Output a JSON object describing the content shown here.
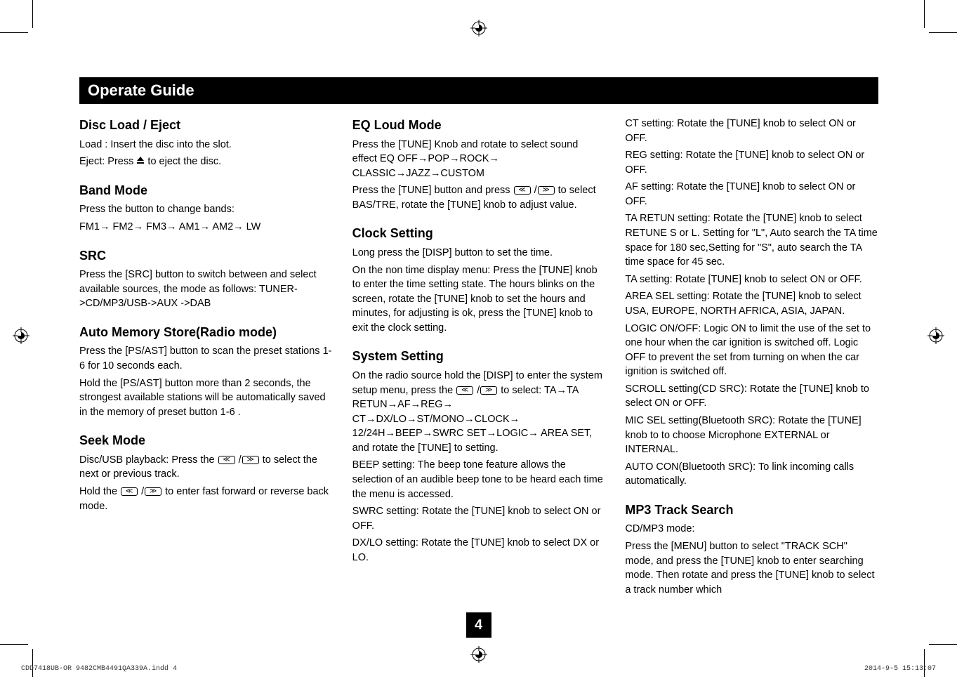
{
  "section_title": "Operate Guide",
  "page_number": "4",
  "footer_left": "CDD7418UB-OR 9482CMB4491QA339A.indd   4",
  "footer_right": "2014-9-5   15:13:07",
  "col1": {
    "h1": "Disc Load / Eject",
    "p1a": "Load : Insert the disc into the slot.",
    "p1b_pre": "Eject: Press ",
    "p1b_post": " to eject the disc.",
    "h2": "Band Mode",
    "p2a": "Press the button to change  bands:",
    "p2b": "FM1→ FM2→ FM3→ AM1→ AM2→ LW",
    "h3": "SRC",
    "p3": "Press the [SRC] button to switch between and select available sources, the mode as follows: TUNER->CD/MP3/USB->AUX ->DAB",
    "h4": "Auto Memory Store(Radio mode)",
    "p4a": "Press the [PS/AST] button to scan the preset stations 1-6 for 10 seconds each.",
    "p4b": "Hold the [PS/AST] button more than 2 seconds, the strongest available stations will be automatically saved in the memory of preset button 1-6 .",
    "h5": "Seek Mode",
    "p5a_pre": "Disc/USB playback: Press the ",
    "p5a_post": " to select the next or previous track.",
    "p5b_pre": "Hold the ",
    "p5b_post": " to enter fast forward or reverse back mode."
  },
  "col2": {
    "h1": "EQ Loud Mode",
    "p1a": "Press the [TUNE] Knob and rotate to select sound effect EQ OFF→POP→ROCK→ CLASSIC→JAZZ→CUSTOM",
    "p1b_pre": "Press the [TUNE] button and press ",
    "p1b_post": " to select BAS/TRE, rotate the [TUNE] knob to adjust value.",
    "h2": "Clock Setting",
    "p2a": "Long press the [DISP] button to set the time.",
    "p2b": "On the non time display menu: Press the [TUNE] knob to enter the time setting state. The hours blinks on the screen, rotate the [TUNE] knob to set the hours and minutes, for adjusting is ok, press the [TUNE] knob to exit the clock setting.",
    "h3": "System Setting",
    "p3a_pre": "On the radio source hold the [DISP] to enter the system setup menu, press the ",
    "p3a_post": " to select: TA→TA RETUN→AF→REG→ CT→DX/LO→ST/MONO→CLOCK→ 12/24H→BEEP→SWRC SET→LOGIC→ AREA SET, and rotate the [TUNE] to setting.",
    "p3b": "BEEP setting: The beep tone feature allows the selection of an audible beep tone to be heard each time the menu is accessed.",
    "p3c": "SWRC setting: Rotate the [TUNE] knob to select ON or OFF.",
    "p3d": "DX/LO setting: Rotate the [TUNE] knob to select DX or LO."
  },
  "col3": {
    "p1": "CT setting: Rotate the [TUNE] knob to select ON or OFF.",
    "p2": "REG setting: Rotate the [TUNE] knob to select ON or OFF.",
    "p3": "AF setting: Rotate the [TUNE] knob to select ON or OFF.",
    "p4": "TA RETUN setting: Rotate the [TUNE] knob to select RETUNE S or L. Setting for \"L\", Auto search the TA time space for 180 sec,Setting for \"S\", auto search the TA time space for 45 sec.",
    "p5": "TA setting: Rotate [TUNE] knob to select ON or OFF.",
    "p6": "AREA SEL setting: Rotate the [TUNE] knob to select USA, EUROPE, NORTH AFRICA, ASIA, JAPAN.",
    "p7": "LOGIC ON/OFF: Logic ON to limit the use of the set to one hour when the car ignition is switched off. Logic OFF to prevent the set from turning on when the car ignition is switched off.",
    "p8": "SCROLL setting(CD SRC): Rotate the [TUNE] knob to select ON or OFF.",
    "p9": "MIC SEL setting(Bluetooth SRC): Rotate the [TUNE] knob to to choose Microphone EXTERNAL or INTERNAL.",
    "p10": "AUTO CON(Bluetooth SRC): To link incoming calls automatically.",
    "h11": "MP3 Track Search",
    "p11a": "CD/MP3 mode:",
    "p11b": "Press the [MENU] button to select \"TRACK SCH\" mode, and press the [TUNE] knob to enter searching mode. Then rotate and press the [TUNE] knob to select a track number which"
  }
}
